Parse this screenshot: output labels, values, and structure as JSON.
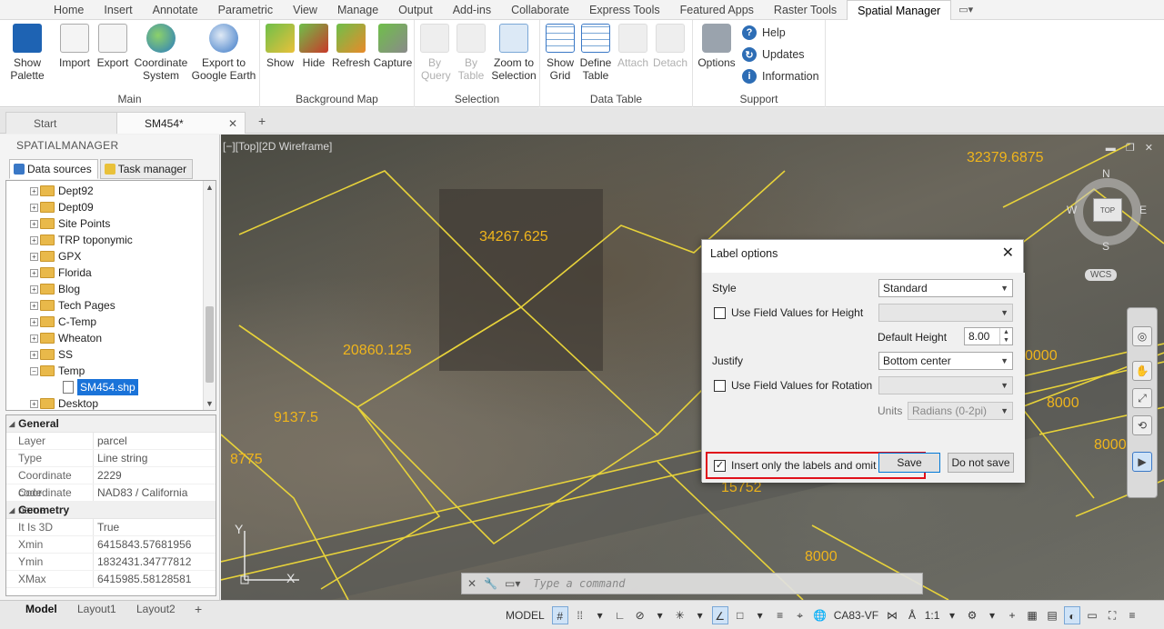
{
  "ribbon_tabs": [
    "Home",
    "Insert",
    "Annotate",
    "Parametric",
    "View",
    "Manage",
    "Output",
    "Add-ins",
    "Collaborate",
    "Express Tools",
    "Featured Apps",
    "Raster Tools",
    "Spatial Manager"
  ],
  "ribbon_tab_extra": "▭▾",
  "panels": {
    "main": {
      "title": "Main",
      "buttons": [
        "Show Palette",
        "Import",
        "Export",
        "Coordinate System",
        "Export to Google Earth"
      ]
    },
    "background_map": {
      "title": "Background Map",
      "buttons": [
        "Show",
        "Hide",
        "Refresh",
        "Capture"
      ]
    },
    "selection": {
      "title": "Selection",
      "buttons": [
        "By Query",
        "By Table",
        "Zoom to Selection"
      ]
    },
    "data_table": {
      "title": "Data Table",
      "buttons": [
        "Show Grid",
        "Define Table",
        "Attach",
        "Detach"
      ]
    },
    "support": {
      "title": "Support",
      "options_label": "Options",
      "items": [
        "Help",
        "Updates",
        "Information"
      ]
    }
  },
  "doc_tabs": {
    "start": "Start",
    "current": "SM454*",
    "add": "+"
  },
  "palette": {
    "title": "SPATIALMANAGER",
    "tabs": [
      "Data sources",
      "Task manager"
    ],
    "tree": [
      "Dept92",
      "Dept09",
      "Site Points",
      "TRP toponymic",
      "GPX",
      "Florida",
      "Blog",
      "Tech Pages",
      "C-Temp",
      "Wheaton",
      "SS",
      "Temp"
    ],
    "selected_file": "SM454.shp",
    "last_item": "Desktop",
    "properties": {
      "general_title": "General",
      "general": [
        [
          "Layer",
          "parcel"
        ],
        [
          "Type",
          "Line string"
        ],
        [
          "Coordinate code",
          "2229"
        ],
        [
          "Coordinate name",
          "NAD83 / California"
        ]
      ],
      "geometry_title": "Geometry",
      "geometry": [
        [
          "It Is 3D",
          "True"
        ],
        [
          "Xmin",
          "6415843.57681956"
        ],
        [
          "Ymin",
          "1832431.34777812"
        ],
        [
          "XMax",
          "6415985.58128581"
        ]
      ]
    }
  },
  "viewport": {
    "label": "[−][Top][2D Wireframe]",
    "parcel_labels": [
      "34267.625",
      "32379.6875",
      "20860.125",
      "9137.5",
      "8775",
      "15752",
      "8000",
      "8000",
      "8000",
      "0000"
    ],
    "compass": {
      "n": "N",
      "s": "S",
      "e": "E",
      "w": "W",
      "top": "TOP",
      "wcs": "WCS"
    },
    "ucs": {
      "y": "Y",
      "x": "X"
    },
    "command_placeholder": "Type a command"
  },
  "dialog": {
    "title": "Label options",
    "style_label": "Style",
    "style_value": "Standard",
    "use_height_label": "Use Field Values for Height",
    "default_height_label": "Default Height",
    "default_height_value": "8.00",
    "justify_label": "Justify",
    "justify_value": "Bottom center",
    "use_rotation_label": "Use Field Values for Rotation",
    "units_label": "Units",
    "units_value": "Radians (0-2pi)",
    "insert_only_label": "Insert only the labels and omit the objects",
    "save_label": "Save",
    "do_not_save_label": "Do not save"
  },
  "statusbar": {
    "layout_tabs": [
      "Model",
      "Layout1",
      "Layout2"
    ],
    "add": "+",
    "model": "MODEL",
    "coord_system": "CA83-VF",
    "scale": "1:1"
  }
}
